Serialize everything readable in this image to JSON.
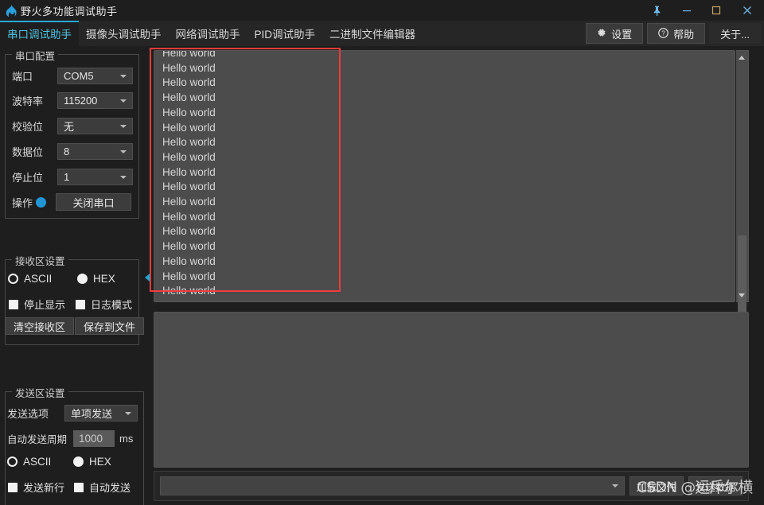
{
  "window": {
    "title": "野火多功能调试助手",
    "logo_icon": "flame-icon",
    "controls": [
      {
        "name": "pin-button",
        "icon": "pin-icon",
        "glyph": "📌"
      },
      {
        "name": "minimize-button",
        "icon": "minimize-icon",
        "glyph": "—"
      },
      {
        "name": "maximize-button",
        "icon": "maximize-icon",
        "glyph": "▢"
      },
      {
        "name": "close-button",
        "icon": "close-icon",
        "glyph": "✕"
      }
    ]
  },
  "tabs": [
    {
      "label": "串口调试助手",
      "active": true
    },
    {
      "label": "摄像头调试助手",
      "active": false
    },
    {
      "label": "网络调试助手",
      "active": false
    },
    {
      "label": "PID调试助手",
      "active": false
    },
    {
      "label": "二进制文件编辑器",
      "active": false
    }
  ],
  "toolbar": {
    "settings_label": "设置",
    "settings_icon": "gear-icon",
    "help_label": "帮助",
    "help_icon": "question-circle-icon",
    "about_label": "关于..."
  },
  "sidebar": {
    "serial_config": {
      "legend": "串口配置",
      "fields": [
        {
          "label": "端口",
          "value": "COM5"
        },
        {
          "label": "波特率",
          "value": "115200"
        },
        {
          "label": "校验位",
          "value": "无"
        },
        {
          "label": "数据位",
          "value": "8"
        },
        {
          "label": "停止位",
          "value": "1"
        }
      ],
      "operation_label": "操作",
      "status_color": "#2196d6",
      "toggle_button": "关闭串口"
    },
    "receive_settings": {
      "legend": "接收区设置",
      "ascii_label": "ASCII",
      "ascii_selected": false,
      "hex_label": "HEX",
      "hex_selected": true,
      "stop_display_label": "停止显示",
      "log_mode_label": "日志模式",
      "clear_button": "清空接收区",
      "save_button": "保存到文件"
    },
    "send_settings": {
      "legend": "发送区设置",
      "send_option_label": "发送选项",
      "send_option_value": "单项发送",
      "auto_period_label": "自动发送周期",
      "auto_period_value": "1000",
      "auto_period_unit": "ms",
      "ascii_label": "ASCII",
      "ascii_selected": false,
      "hex_label": "HEX",
      "hex_selected": true,
      "newline_label": "发送新行",
      "auto_send_label": "自动发送"
    }
  },
  "receive_area": {
    "lines": [
      "Hello world",
      "Hello world",
      "Hello world",
      "Hello world",
      "Hello world",
      "Hello world",
      "Hello world",
      "Hello world",
      "Hello world",
      "Hello world",
      "Hello world",
      "Hello world",
      "Hello world",
      "Hello world",
      "Hello world",
      "Hello world",
      "Hello world"
    ]
  },
  "send_input": {
    "value": "",
    "placeholder": ""
  },
  "bottom_bar": {
    "load_file_button": "加载文件",
    "send_data_button": "发送数据"
  },
  "annotations": {
    "highlight_color": "#f23b3b",
    "collapse_handle_icon": "triangle-left-icon",
    "watermark_text": "CSDN @运斥尔横"
  }
}
